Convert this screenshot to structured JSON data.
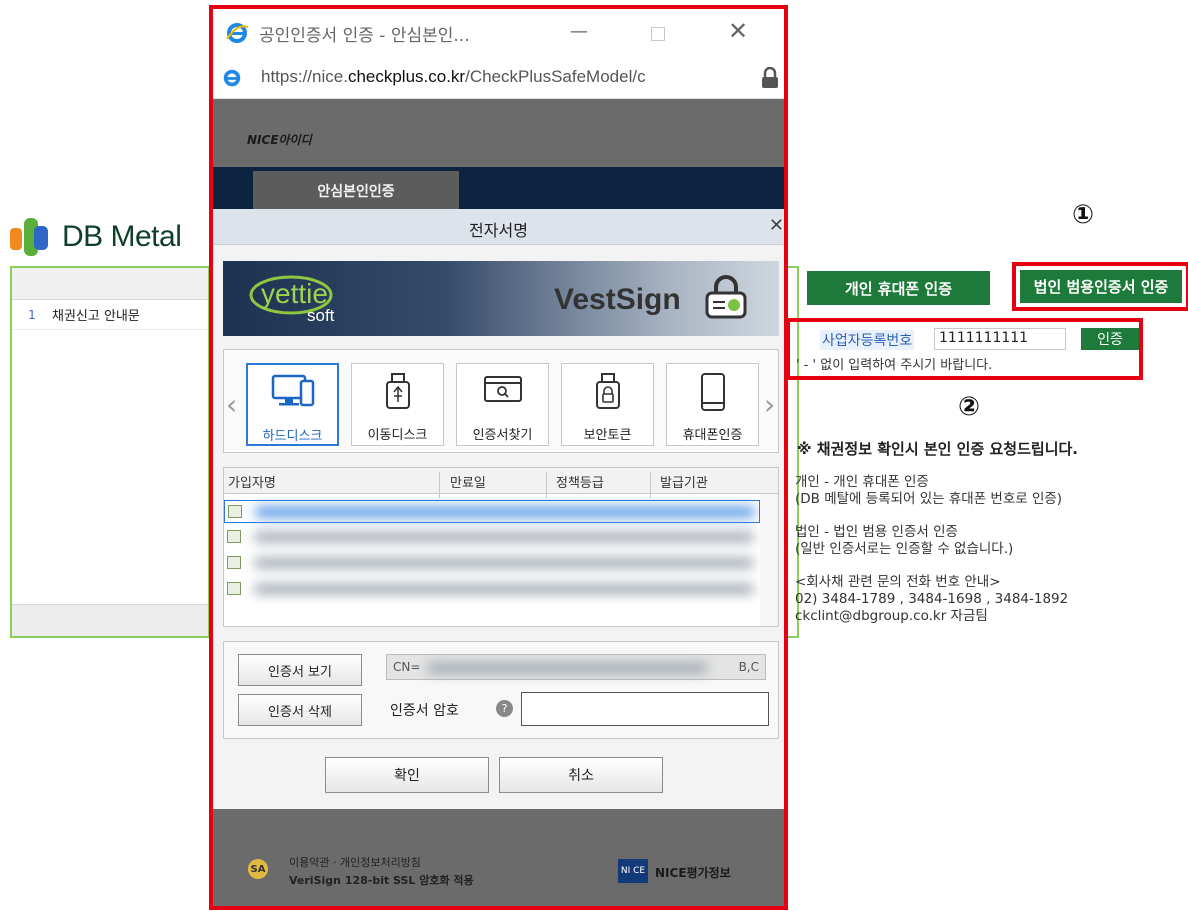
{
  "background_page": {
    "brand_name": "DB Metal",
    "table_rows": [
      {
        "no": "1",
        "title": "채권신고 안내문"
      }
    ],
    "markers": {
      "one": "①",
      "two": "②"
    },
    "buttons": {
      "personal_phone": "개인 휴대폰 인증",
      "corporate_cert": "법인 범용인증서 인증"
    },
    "biz_number": {
      "label": "사업자등록번호",
      "value": "1111111111",
      "button": "인증",
      "help": "' - ' 없이 입력하여 주시기 바랍니다."
    },
    "notice": {
      "title": "※ 채권정보 확인시 본인 인증 요청드립니다.",
      "personal_line1": "개인 - 개인 휴대폰 인증",
      "personal_line2": "(DB 메탈에 등록되어 있는 휴대폰 번호로 인증)",
      "corp_line1": "법인 - 법인 범용 인증서 인증",
      "corp_line2": "(일반 인증서로는 인증할 수 없습니다.)",
      "contact_title": "<회사채 관련 문의 전화 번호 안내>",
      "contact_phones": "02) 3484-1789 , 3484-1698 , 3484-1892",
      "contact_email": "ckclint@dbgroup.co.kr 자금팀"
    }
  },
  "popup": {
    "window_title": "공인인증서 인증 - 안심본인...",
    "url_prefix": "https://nice.",
    "url_domain": "checkplus.co.kr",
    "url_path": "/CheckPlusSafeModel/c",
    "nice_logo": "NICE아이디",
    "nice_tab": "안심본인인증",
    "footer_line1": "이용약관 · 개인정보처리방침",
    "footer_line2": "VeriSign 128-bit SSL 암호화 적용",
    "footer_brand": "NICE평가정보",
    "footer_ce": "NI CE",
    "footer_sa": "SA"
  },
  "dialog": {
    "title": "전자서명",
    "banner_left_top": "yettie",
    "banner_left_bottom": "soft",
    "banner_right": "VestSign",
    "storage_options": [
      {
        "label": "하드디스크",
        "icon": "monitor-icon",
        "active": true
      },
      {
        "label": "이동디스크",
        "icon": "usb-icon",
        "active": false
      },
      {
        "label": "인증서찾기",
        "icon": "search-window-icon",
        "active": false
      },
      {
        "label": "보안토큰",
        "icon": "token-lock-icon",
        "active": false
      },
      {
        "label": "휴대폰인증",
        "icon": "smartphone-icon",
        "active": false
      }
    ],
    "cert_columns": [
      "가입자명",
      "만료일",
      "정책등급",
      "발급기관"
    ],
    "cert_detail": {
      "cn_prefix": "CN=",
      "cn_suffix": "B,C",
      "view_button": "인증서 보기",
      "delete_button": "인증서 삭제",
      "password_label": "인증서 암호",
      "help_glyph": "?"
    },
    "ok_button": "확인",
    "cancel_button": "취소"
  },
  "colors": {
    "highlight_red": "#e60012",
    "button_green": "#1d7a3a",
    "frame_green": "#8ccf5c",
    "nice_navy": "#0c2440"
  }
}
